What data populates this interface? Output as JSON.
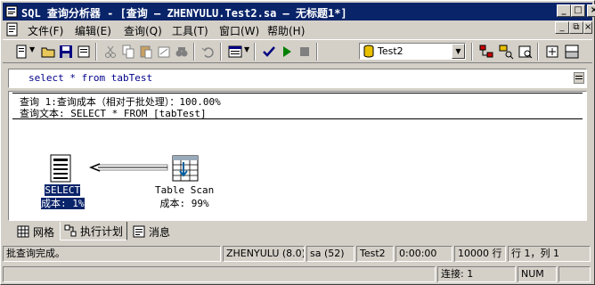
{
  "window": {
    "title": "SQL 查询分析器 - [查询 — ZHENYULU.Test2.sa — 无标题1*]"
  },
  "menu": {
    "items": [
      {
        "label": "文件(F)"
      },
      {
        "label": "编辑(E)"
      },
      {
        "label": "查询(Q)"
      },
      {
        "label": "工具(T)"
      },
      {
        "label": "窗口(W)"
      },
      {
        "label": "帮助(H)"
      }
    ]
  },
  "toolbar": {
    "database": "Test2"
  },
  "editor": {
    "query_text": "select * from tabTest"
  },
  "results": {
    "header_line1": "查询 1:查询成本（相对于批处理）：100.00%",
    "header_line2": "查询文本: SELECT * FROM [tabTest]",
    "nodes": [
      {
        "name": "SELECT",
        "cost": "成本: 1%"
      },
      {
        "name": "Table Scan",
        "cost": "成本: 99%"
      }
    ]
  },
  "tabs": [
    {
      "label": "网格"
    },
    {
      "label": "执行计划"
    },
    {
      "label": "消息"
    }
  ],
  "status": {
    "message": "批查询完成。",
    "server": "ZHENYULU (8.0)",
    "user": "sa (52)",
    "database": "Test2",
    "elapsed": "0:00:00",
    "rows": "10000 行",
    "position": "行 1，列 1",
    "connections": "连接: 1",
    "num": "NUM"
  },
  "colors": {
    "titlebar": "#0a246a",
    "chrome": "#d4d0c8",
    "selection": "#0a246a"
  }
}
